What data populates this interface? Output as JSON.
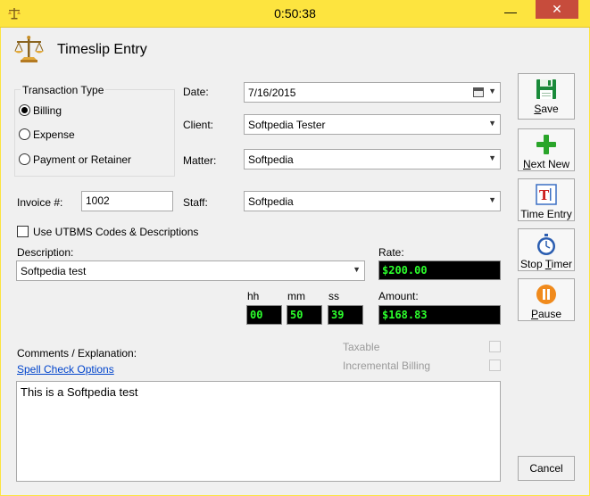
{
  "window": {
    "title": "0:50:38",
    "minimize_glyph": "—",
    "close_glyph": "✕",
    "app_icon": "scales-icon"
  },
  "header": {
    "title": "Timeslip Entry",
    "icon": "scales-icon"
  },
  "transaction_type": {
    "legend": "Transaction Type",
    "options": [
      {
        "label": "Billing",
        "checked": true
      },
      {
        "label": "Expense",
        "checked": false
      },
      {
        "label": "Payment or Retainer",
        "checked": false
      }
    ]
  },
  "form": {
    "date_label": "Date:",
    "date_value": "7/16/2015",
    "client_label": "Client:",
    "client_value": "Softpedia Tester",
    "matter_label": "Matter:",
    "matter_value": "Softpedia",
    "staff_label": "Staff:",
    "staff_value": "Softpedia",
    "invoice_label": "Invoice #:",
    "invoice_value": "1002",
    "utbms_label": "Use UTBMS Codes & Descriptions",
    "utbms_checked": false,
    "description_label": "Description:",
    "description_value": "Softpedia test",
    "rate_label": "Rate:",
    "rate_value": "$200.00",
    "hh_label": "hh",
    "mm_label": "mm",
    "ss_label": "ss",
    "hh_value": "00",
    "mm_value": "50",
    "ss_value": "39",
    "amount_label": "Amount:",
    "amount_value": "$168.83",
    "comments_label": "Comments / Explanation:",
    "spell_check_link": "Spell Check Options",
    "taxable_label": "Taxable",
    "incremental_label": "Incremental Billing",
    "comments_value": "This is a Softpedia test"
  },
  "actions": {
    "save": {
      "first": "S",
      "rest": "ave"
    },
    "next_new": {
      "first": "N",
      "rest": "ext New"
    },
    "time_entry": {
      "label": "Time Entry"
    },
    "stop_timer": {
      "before": "Stop ",
      "first": "T",
      "rest": "imer"
    },
    "pause": {
      "first": "P",
      "rest": "ause"
    },
    "cancel": "Cancel"
  },
  "colors": {
    "titlebar": "#fde43f",
    "close": "#c74c3c",
    "lcd_text": "#2cff2c",
    "link": "#0044cc"
  }
}
